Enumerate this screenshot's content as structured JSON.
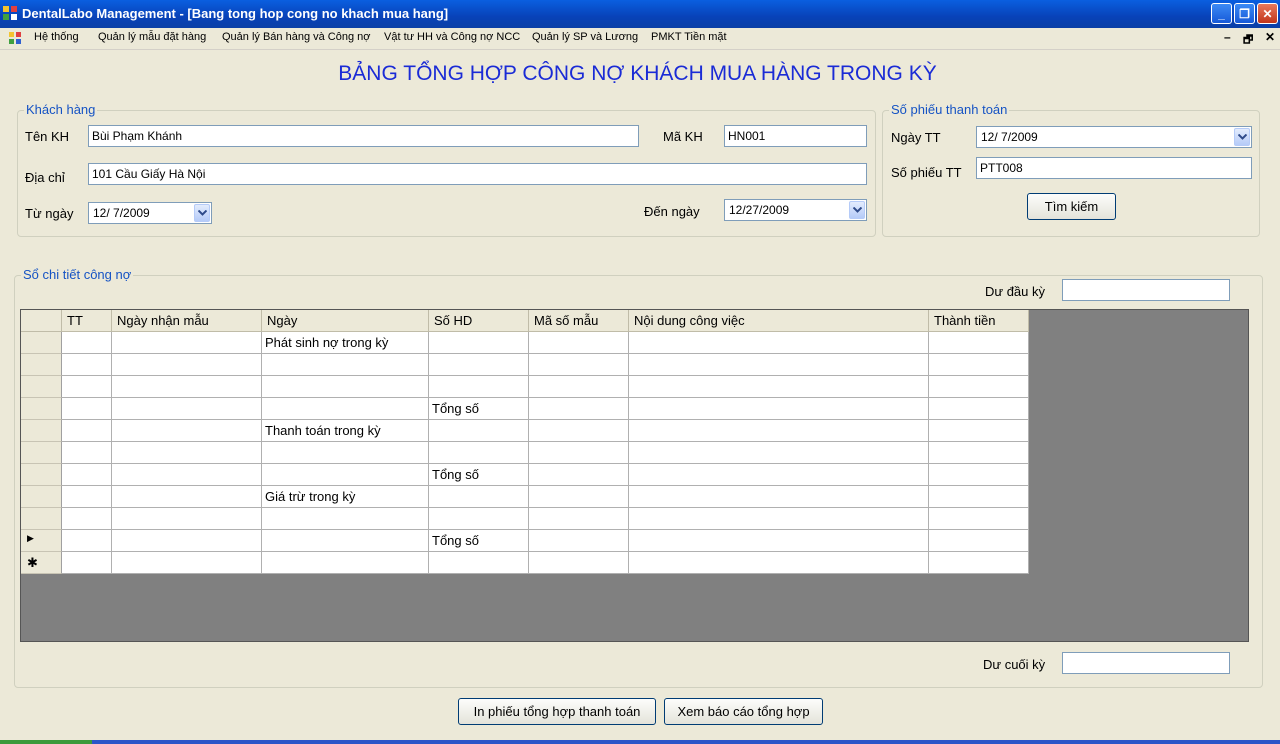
{
  "window": {
    "title": "DentalLabo Management - [Bang tong hop cong no khach mua hang]",
    "minimize": "_",
    "restore": "❐",
    "close": "✕"
  },
  "menu": {
    "items": [
      "Hệ thống",
      "Quản lý mẫu đặt hàng",
      "Quản lý Bán hàng và Công nợ",
      "Vật tư HH và Công nợ NCC",
      "Quản lý SP và Lương",
      "PMKT Tiền mặt"
    ],
    "mdi_minimize": "–",
    "mdi_restore": "🗗",
    "mdi_close": "✕"
  },
  "page_title": "BẢNG TỔNG HỢP CÔNG NỢ KHÁCH MUA HÀNG TRONG KỲ",
  "customer": {
    "legend": "Khách hàng",
    "name_label": "Tên KH",
    "name_value": "Bùi Phạm Khánh",
    "code_label": "Mã KH",
    "code_value": "HN001",
    "address_label": "Địa chỉ",
    "address_value": "101 Cầu Giấy Hà Nội",
    "from_label": "Từ ngày",
    "from_value": "12/  7/2009",
    "to_label": "Đến ngày",
    "to_value": "12/27/2009"
  },
  "payment": {
    "legend": "Số phiếu thanh toán",
    "date_label": "Ngày TT",
    "date_value": "12/  7/2009",
    "number_label": "Số phiếu TT",
    "number_value": "PTT008",
    "search_button": "Tìm kiếm"
  },
  "ledger": {
    "legend": "Sổ chi tiết công nợ",
    "opening_label": "Dư đầu kỳ",
    "opening_value": "",
    "closing_label": "Dư cuối kỳ",
    "closing_value": "",
    "columns": [
      "TT",
      "Ngày nhận mẫu",
      "Ngày",
      "Số HD",
      "Mã số mẫu",
      "Nội dung công việc",
      "Thành tiền"
    ],
    "rows": [
      [
        "",
        "",
        "Phát sinh nợ trong kỳ",
        "",
        "",
        "",
        ""
      ],
      [
        "",
        "",
        "",
        "",
        "",
        "",
        ""
      ],
      [
        "",
        "",
        "",
        "",
        "",
        "",
        ""
      ],
      [
        "",
        "",
        "",
        "Tổng số",
        "",
        "",
        ""
      ],
      [
        "",
        "",
        "Thanh toán trong kỳ",
        "",
        "",
        "",
        ""
      ],
      [
        "",
        "",
        "",
        "",
        "",
        "",
        ""
      ],
      [
        "",
        "",
        "",
        "Tổng số",
        "",
        "",
        ""
      ],
      [
        "",
        "",
        "Giá trừ trong kỳ",
        "",
        "",
        "",
        ""
      ],
      [
        "",
        "",
        "",
        "",
        "",
        "",
        ""
      ],
      [
        "",
        "",
        "",
        "Tổng số",
        "",
        "",
        ""
      ],
      [
        "",
        "",
        "",
        "",
        "",
        "",
        ""
      ]
    ],
    "current_row_marker": "▶",
    "new_row_marker": "✱"
  },
  "buttons": {
    "print": "In phiếu tổng hợp thanh toán",
    "report": "Xem báo cáo tổng hợp"
  }
}
